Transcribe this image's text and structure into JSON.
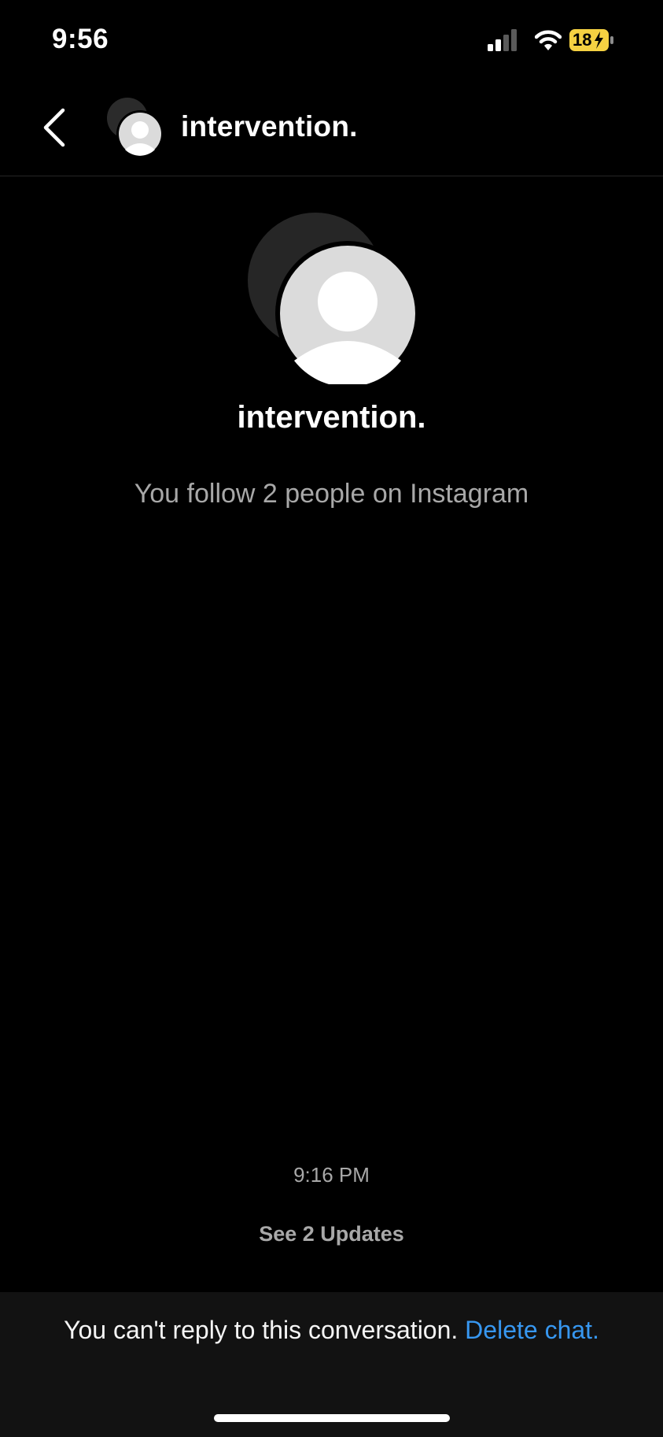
{
  "status_bar": {
    "time": "9:56",
    "battery_level": "18",
    "battery_color": "#f5d142",
    "icons": [
      "signal-icon",
      "wifi-icon",
      "battery-charging-icon"
    ]
  },
  "header": {
    "back_icon": "chevron-left-icon",
    "title": "intervention."
  },
  "profile": {
    "name": "intervention.",
    "subtitle": "You follow 2 people on Instagram"
  },
  "thread": {
    "timestamp": "9:16 PM",
    "updates_label": "See 2 Updates"
  },
  "footer": {
    "message": "You can't reply to this conversation.",
    "delete_label": "Delete chat.",
    "link_color": "#3797f0"
  }
}
